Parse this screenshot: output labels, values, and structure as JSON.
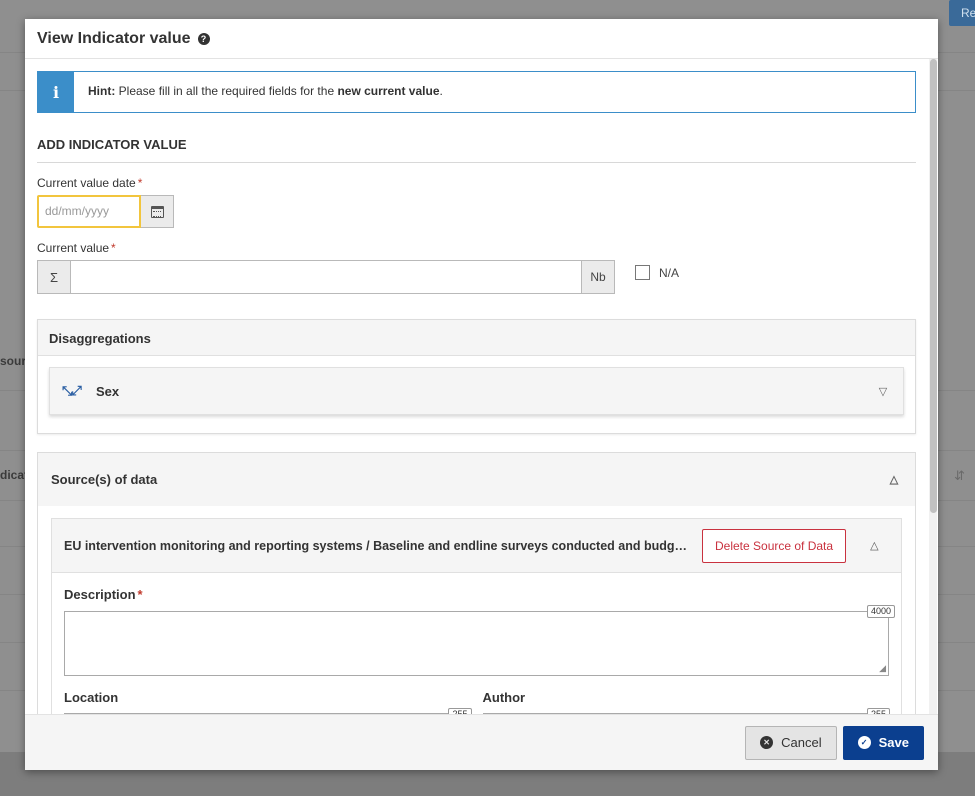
{
  "background": {
    "top_button": "Re",
    "row_label_1": "sour",
    "row_label_2": "dicat",
    "sort_icon": "sort-icon"
  },
  "modal": {
    "title": "View Indicator value",
    "help_icon": "question-circle-icon",
    "hint": {
      "icon": "info-icon",
      "prefix": "Hint:",
      "text_before": " Please fill in all the required fields for the ",
      "emphasis": "new current value",
      "text_after": "."
    },
    "section_title": "ADD INDICATOR VALUE",
    "current_value_date": {
      "label": "Current value date",
      "required": "*",
      "placeholder": "dd/mm/yyyy",
      "calendar_icon": "calendar-icon"
    },
    "current_value": {
      "label": "Current value",
      "required": "*",
      "prefix": "Σ",
      "suffix": "Nb",
      "value": "",
      "na_label": "N/A"
    },
    "disaggregations": {
      "title": "Disaggregations",
      "items": [
        {
          "label": "Sex",
          "icon": "expand-icon",
          "chevron": "chevron-down-icon"
        }
      ]
    },
    "sources": {
      "title": "Source(s) of data",
      "chevron": "chevron-up-icon",
      "items": [
        {
          "title": "EU intervention monitoring and reporting systems / Baseline and endline surveys conducted and budge...",
          "delete_label": "Delete Source of Data",
          "chevron": "chevron-up-icon",
          "description_label": "Description",
          "description_required": "*",
          "description_max": "4000",
          "location_label": "Location",
          "location_max": "255",
          "author_label": "Author",
          "author_max": "255"
        }
      ]
    },
    "footer": {
      "cancel_label": "Cancel",
      "save_label": "Save"
    }
  }
}
